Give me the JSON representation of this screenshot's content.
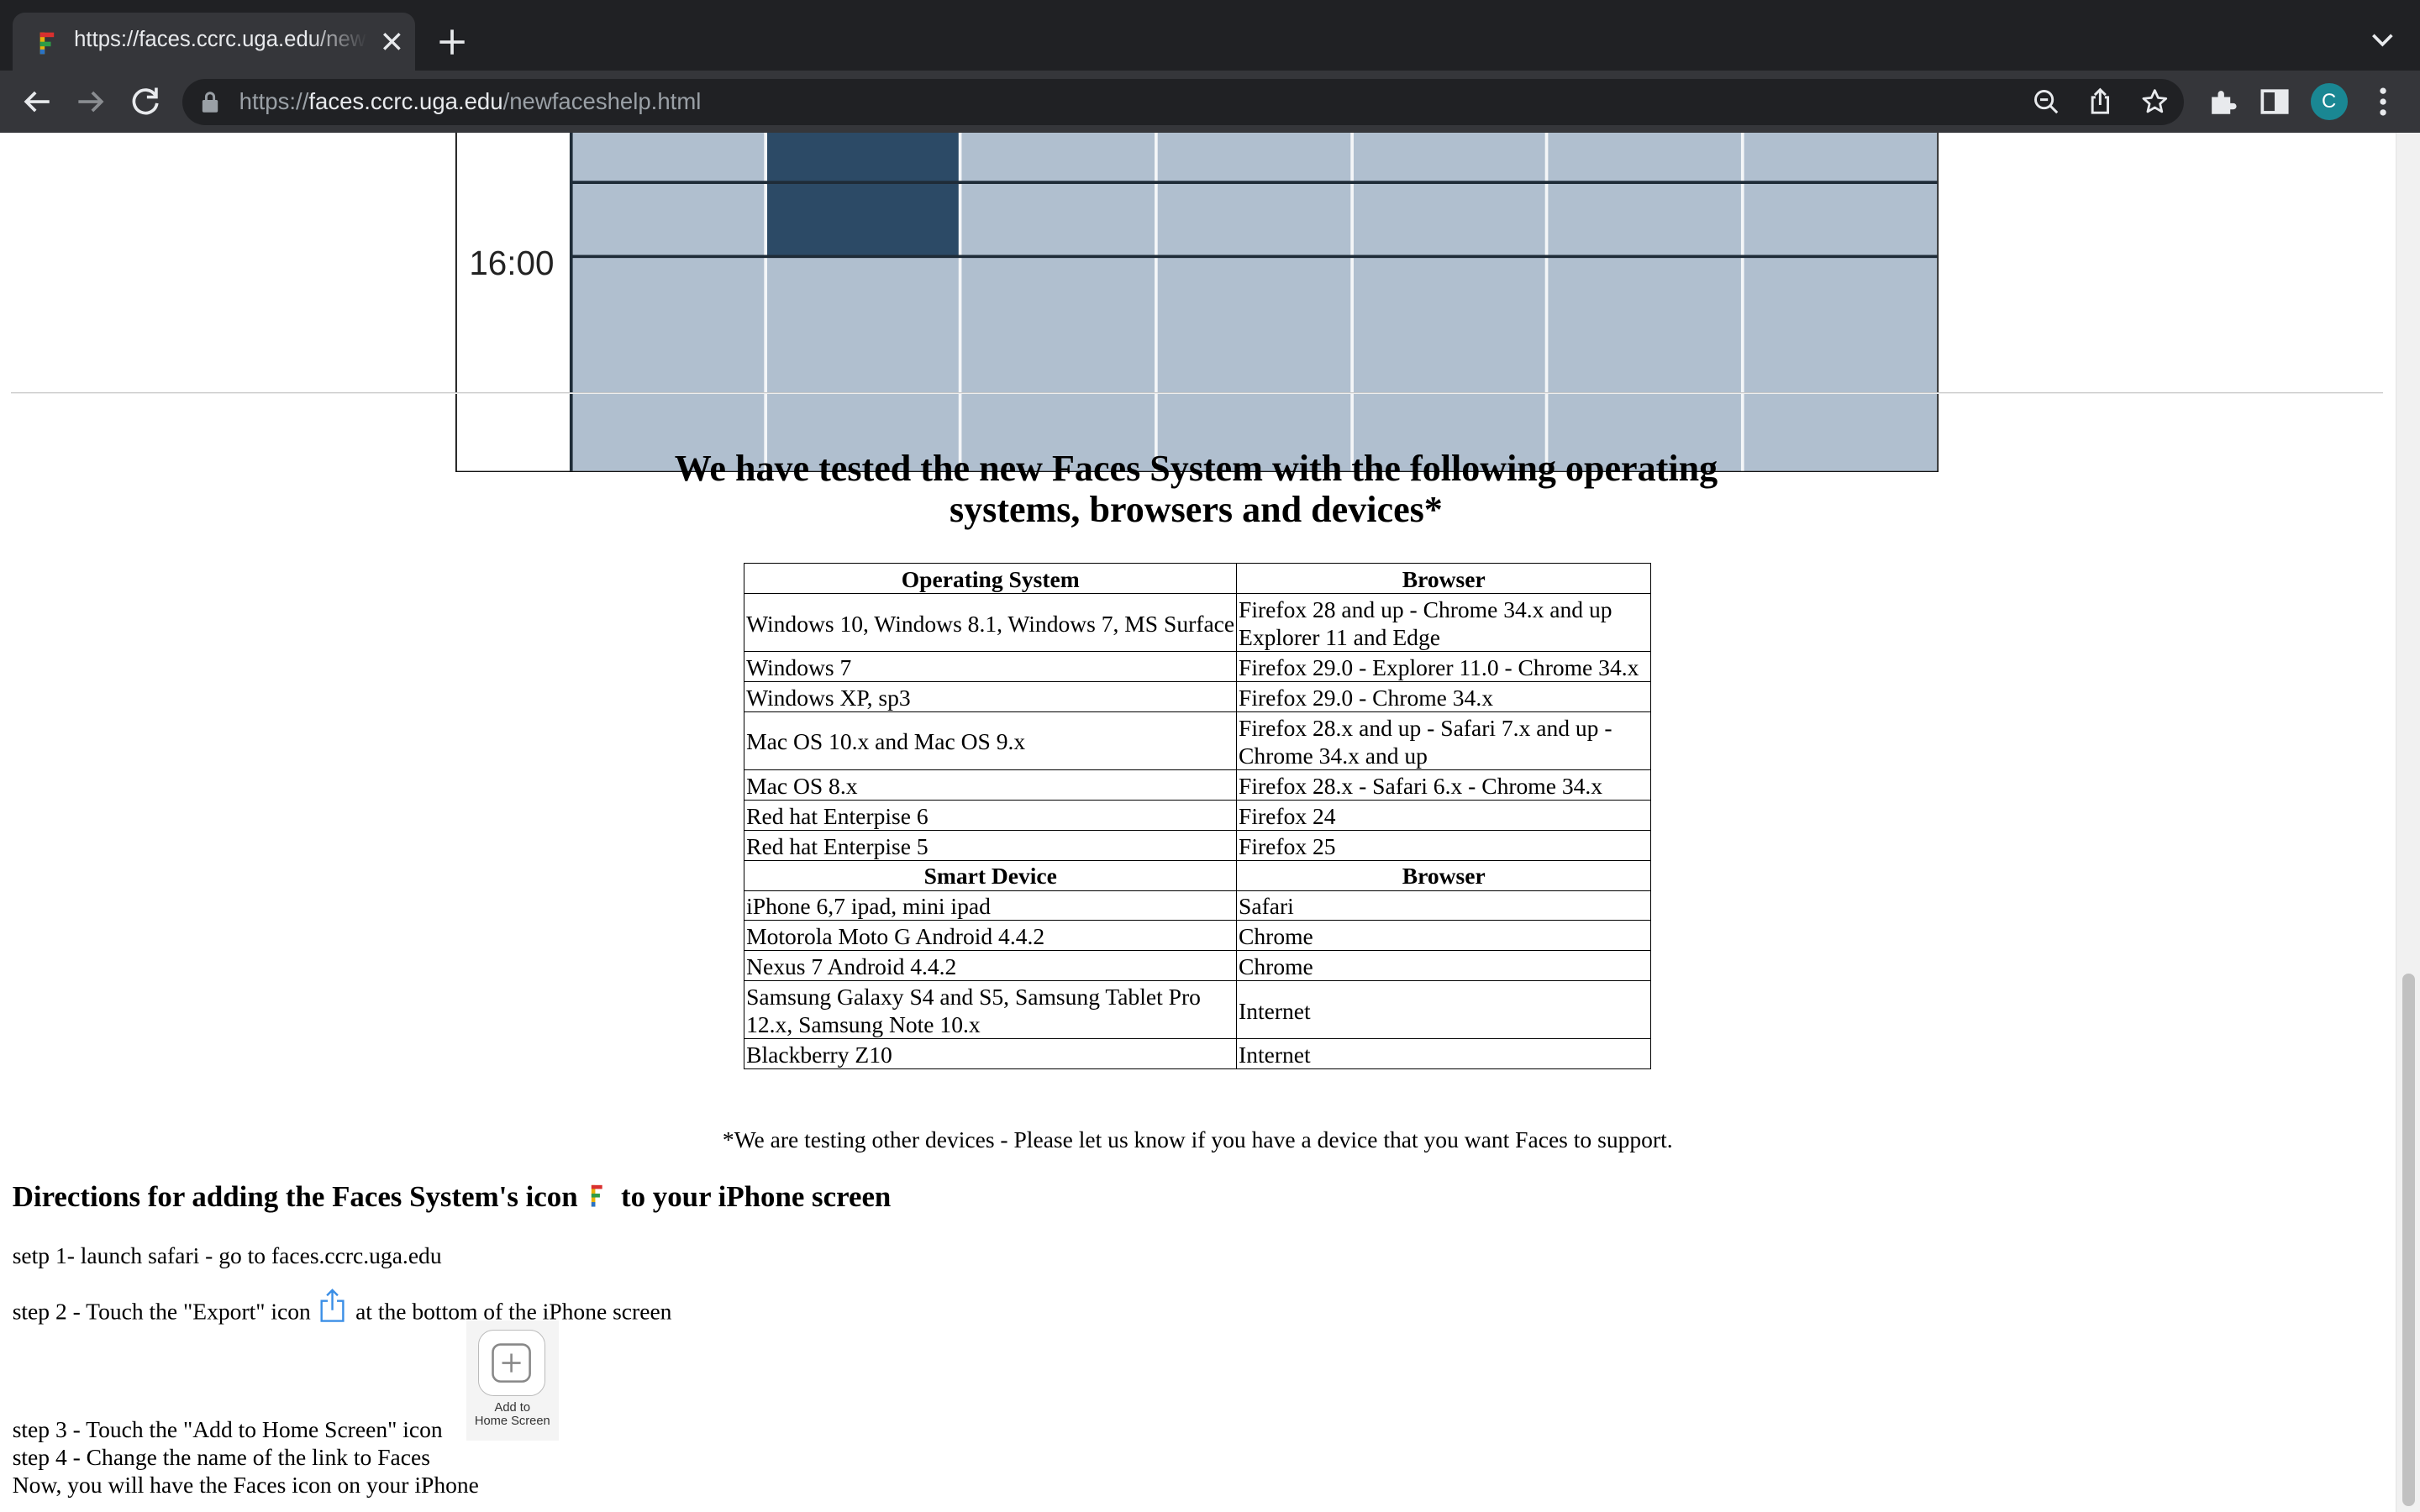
{
  "browser": {
    "tab_title": "https://faces.ccrc.uga.edu/newfaceshelp.html",
    "url_scheme": "https://",
    "url_host": "faces.ccrc.uga.edu",
    "url_path": "/newfaceshelp.html",
    "profile_initial": "C",
    "accent_color": "#1a8793"
  },
  "schedule": {
    "time_label": "16:00",
    "cell_color": "#b0bfcf",
    "selected_color": "#2c4a66"
  },
  "page": {
    "heading": "We have tested the new Faces System with the following operating systems, browsers and devices*",
    "table": {
      "os_header": "Operating System",
      "browser_header": "Browser",
      "os_rows": [
        [
          "Windows 10, Windows 8.1, Windows 7, MS Surface",
          "Firefox 28 and up - Chrome 34.x and up Explorer 11 and Edge"
        ],
        [
          "Windows 7",
          "Firefox 29.0 - Explorer 11.0 - Chrome 34.x"
        ],
        [
          "Windows XP, sp3",
          "Firefox 29.0 - Chrome 34.x"
        ],
        [
          "Mac OS 10.x and Mac OS 9.x",
          "Firefox 28.x and up - Safari 7.x and up - Chrome 34.x and up"
        ],
        [
          "Mac OS 8.x",
          "Firefox 28.x - Safari 6.x - Chrome 34.x"
        ],
        [
          "Red hat Enterpise 6",
          "Firefox 24"
        ],
        [
          "Red hat Enterpise 5",
          "Firefox 25"
        ]
      ],
      "device_header": "Smart Device",
      "device_browser_header": "Browser",
      "device_rows": [
        [
          "iPhone 6,7 ipad, mini ipad",
          "Safari"
        ],
        [
          "Motorola Moto G Android 4.4.2",
          "Chrome"
        ],
        [
          "Nexus 7 Android 4.4.2",
          "Chrome"
        ],
        [
          "Samsung Galaxy S4 and S5, Samsung Tablet Pro 12.x, Samsung Note 10.x",
          "Internet"
        ],
        [
          "Blackberry Z10",
          "Internet"
        ]
      ]
    },
    "footnote": "*We are testing other devices - Please let us know if you have a device that you want Faces to support.",
    "directions_before": "Directions for adding the Faces System's icon",
    "directions_after": "to your iPhone screen",
    "step1": "setp 1- launch safari - go to faces.ccrc.uga.edu",
    "step2_before": "step 2 - Touch the \"Export\" icon",
    "step2_after": "at the bottom of the iPhone screen",
    "add_home_label_1": "Add to",
    "add_home_label_2": "Home Screen",
    "step3": "step 3 - Touch the \"Add to Home Screen\" icon",
    "step4": "step 4 - Change the name of the link to Faces",
    "step5": "Now, you will have the Faces icon on your iPhone"
  }
}
